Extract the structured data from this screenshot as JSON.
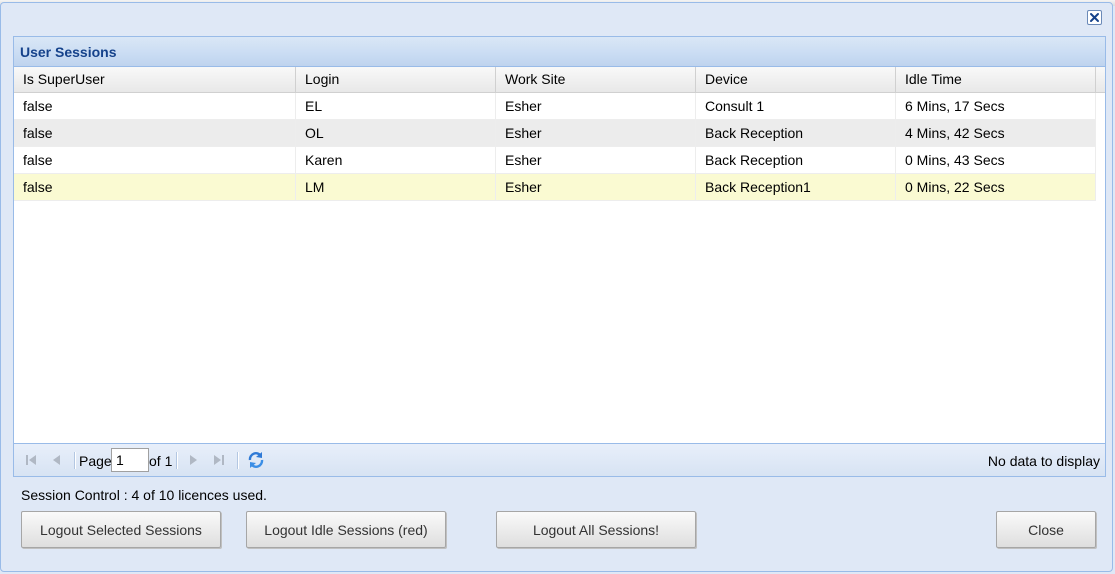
{
  "window": {
    "close_icon": "close-icon"
  },
  "panel": {
    "title": "User Sessions"
  },
  "grid": {
    "columns": [
      "Is SuperUser",
      "Login",
      "Work Site",
      "Device",
      "Idle Time"
    ],
    "rows": [
      {
        "superuser": "false",
        "login": "EL",
        "site": "Esher",
        "device": "Consult 1",
        "idle": "6 Mins, 17 Secs"
      },
      {
        "superuser": "false",
        "login": "OL",
        "site": "Esher",
        "device": "Back Reception",
        "idle": "4 Mins, 42 Secs"
      },
      {
        "superuser": "false",
        "login": "Karen",
        "site": "Esher",
        "device": "Back Reception",
        "idle": "0 Mins, 43 Secs"
      },
      {
        "superuser": "false",
        "login": "LM",
        "site": "Esher",
        "device": "Back Reception1",
        "idle": "0 Mins, 22 Secs"
      }
    ],
    "selected_row_color": "#fafad2",
    "alt_row_color": "#ececec"
  },
  "paging": {
    "page_label": "Page",
    "page_value": "1",
    "of_label": "of 1",
    "display_text": "No data to display",
    "icons": [
      "first-page-icon",
      "prev-page-icon",
      "next-page-icon",
      "last-page-icon",
      "refresh-icon"
    ]
  },
  "status": {
    "text": "Session Control : 4 of 10 licences used."
  },
  "buttons": {
    "logout_selected": "Logout Selected Sessions",
    "logout_idle": "Logout Idle Sessions (red)",
    "logout_all": "Logout All Sessions!",
    "close": "Close"
  },
  "colors": {
    "header_text": "#15428b",
    "border": "#99bbe8",
    "window_bg": "#dfe8f6"
  }
}
